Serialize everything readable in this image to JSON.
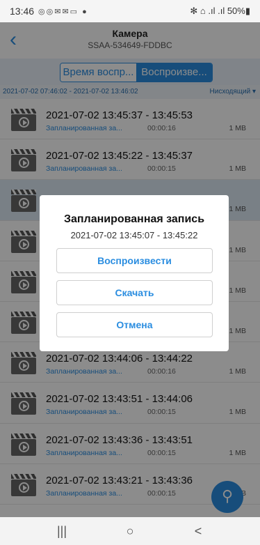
{
  "status_bar": {
    "time": "13:46",
    "icons": "◎◎✉✉▭ ●",
    "right": "✻ ⌂ .ıl .ıl 50%▮"
  },
  "header": {
    "title": "Камера",
    "subtitle": "SSAA-534649-FDDBC",
    "back_icon": "chevron-left-icon"
  },
  "segments": {
    "left": "Время воспр...",
    "right": "Воспроизве..."
  },
  "filter": {
    "range": "2021-07-02 07:46:02 - 2021-07-02 13:46:02",
    "sort": "Нисходящий ▾"
  },
  "records": [
    {
      "time_range": "2021-07-02  13:45:37 - 13:45:53",
      "type": "Запланированная за...",
      "duration": "00:00:16",
      "size": "1 MB"
    },
    {
      "time_range": "2021-07-02  13:45:22 - 13:45:37",
      "type": "Запланированная за...",
      "duration": "00:00:15",
      "size": "1 MB"
    },
    {
      "time_range": "",
      "type": "",
      "duration": "",
      "size": "1 MB"
    },
    {
      "time_range": "",
      "type": "",
      "duration": "",
      "size": "1 MB"
    },
    {
      "time_range": "",
      "type": "",
      "duration": "",
      "size": "1 MB"
    },
    {
      "time_range": "",
      "type": "",
      "duration": "",
      "size": "1 MB"
    },
    {
      "time_range": "2021-07-02  13:44:06 - 13:44:22",
      "type": "Запланированная за...",
      "duration": "00:00:16",
      "size": "1 MB"
    },
    {
      "time_range": "2021-07-02  13:43:51 - 13:44:06",
      "type": "Запланированная за...",
      "duration": "00:00:15",
      "size": "1 MB"
    },
    {
      "time_range": "2021-07-02  13:43:36 - 13:43:51",
      "type": "Запланированная за...",
      "duration": "00:00:15",
      "size": "1 MB"
    },
    {
      "time_range": "2021-07-02  13:43:21 - 13:43:36",
      "type": "Запланированная за...",
      "duration": "00:00:15",
      "size": "1 MB"
    }
  ],
  "dialog": {
    "title": "Запланированная запись",
    "time_range": "2021-07-02  13:45:07 - 13:45:22",
    "play": "Воспроизвести",
    "download": "Скачать",
    "cancel": "Отмена"
  },
  "fab": {
    "icon": "search-icon",
    "glyph": "⚲"
  },
  "nav": {
    "recents": "|||",
    "home": "○",
    "back": "<"
  },
  "colors": {
    "accent": "#2a8de0"
  }
}
